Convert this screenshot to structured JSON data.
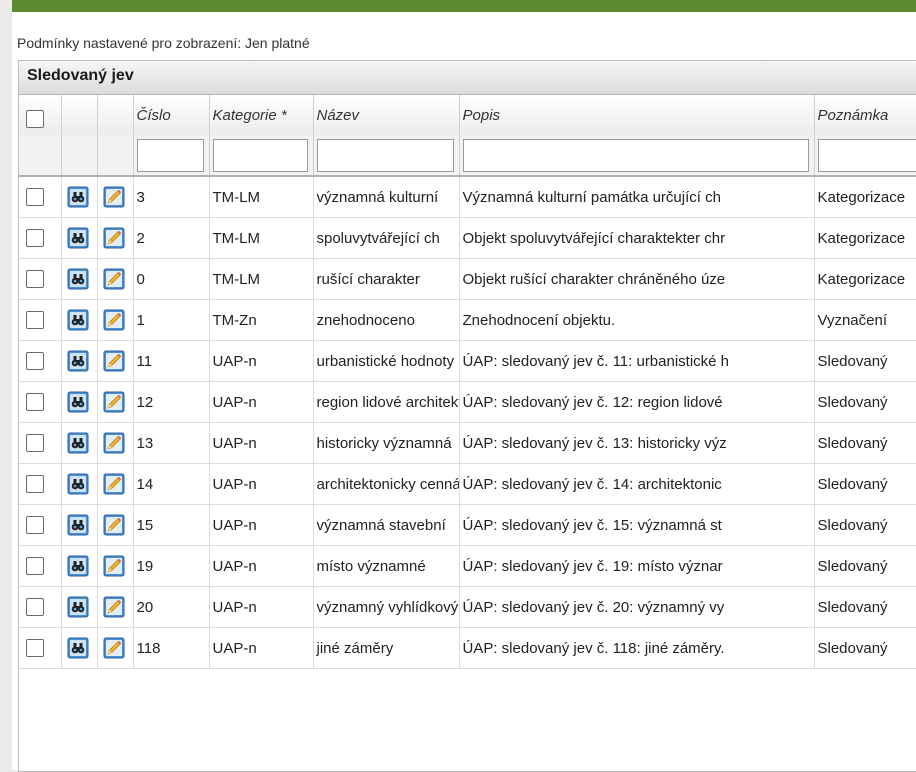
{
  "conditions_text": "Podmínky nastavené pro zobrazení: Jen platné",
  "grid": {
    "title": "Sledovaný jev",
    "columns": [
      "Číslo",
      "Kategorie *",
      "Název",
      "Popis",
      "Poznámka"
    ],
    "rows": [
      {
        "cislo": "3",
        "kategorie": "TM-LM",
        "nazev": "významná kulturní",
        "popis": "Významná kulturní památka určující ch",
        "poznamka": "Kategorizace"
      },
      {
        "cislo": "2",
        "kategorie": "TM-LM",
        "nazev": "spoluvytvářející ch",
        "popis": "Objekt spoluvytvářející charaktekter chr",
        "poznamka": "Kategorizace"
      },
      {
        "cislo": "0",
        "kategorie": "TM-LM",
        "nazev": "rušící charakter",
        "popis": "Objekt rušící charakter chráněného úze",
        "poznamka": "Kategorizace"
      },
      {
        "cislo": "1",
        "kategorie": "TM-Zn",
        "nazev": "znehodnoceno",
        "popis": "Znehodnocení objektu.",
        "poznamka": "Vyznačení"
      },
      {
        "cislo": "11",
        "kategorie": "UAP-n",
        "nazev": "urbanistické hodnoty",
        "popis": "ÚAP: sledovaný jev č. 11: urbanistické h",
        "poznamka": "Sledovaný"
      },
      {
        "cislo": "12",
        "kategorie": "UAP-n",
        "nazev": "region lidové architektury",
        "popis": "ÚAP: sledovaný jev č. 12: region lidové",
        "poznamka": "Sledovaný"
      },
      {
        "cislo": "13",
        "kategorie": "UAP-n",
        "nazev": "historicky významná",
        "popis": "ÚAP: sledovaný jev č. 13: historicky výz",
        "poznamka": "Sledovaný"
      },
      {
        "cislo": "14",
        "kategorie": "UAP-n",
        "nazev": "architektonicky cenná",
        "popis": "ÚAP: sledovaný jev č. 14:  architektonic",
        "poznamka": "Sledovaný"
      },
      {
        "cislo": "15",
        "kategorie": "UAP-n",
        "nazev": "významná stavební",
        "popis": "ÚAP: sledovaný jev č. 15: významná st",
        "poznamka": "Sledovaný"
      },
      {
        "cislo": "19",
        "kategorie": "UAP-n",
        "nazev": "místo významné",
        "popis": "ÚAP: sledovaný jev č. 19: místo význar",
        "poznamka": "Sledovaný"
      },
      {
        "cislo": "20",
        "kategorie": "UAP-n",
        "nazev": "významný vyhlídkový",
        "popis": "ÚAP: sledovaný jev č. 20: významný vy",
        "poznamka": "Sledovaný"
      },
      {
        "cislo": "118",
        "kategorie": "UAP-n",
        "nazev": "jiné záměry",
        "popis": "ÚAP: sledovaný jev č. 118: jiné záměry.",
        "poznamka": "Sledovaný"
      }
    ]
  },
  "icons": {
    "view": "binoculars-icon",
    "edit": "pencil-icon"
  },
  "colors": {
    "accent": "#5e8a2f",
    "icon_bg": "#4a8fd6"
  }
}
